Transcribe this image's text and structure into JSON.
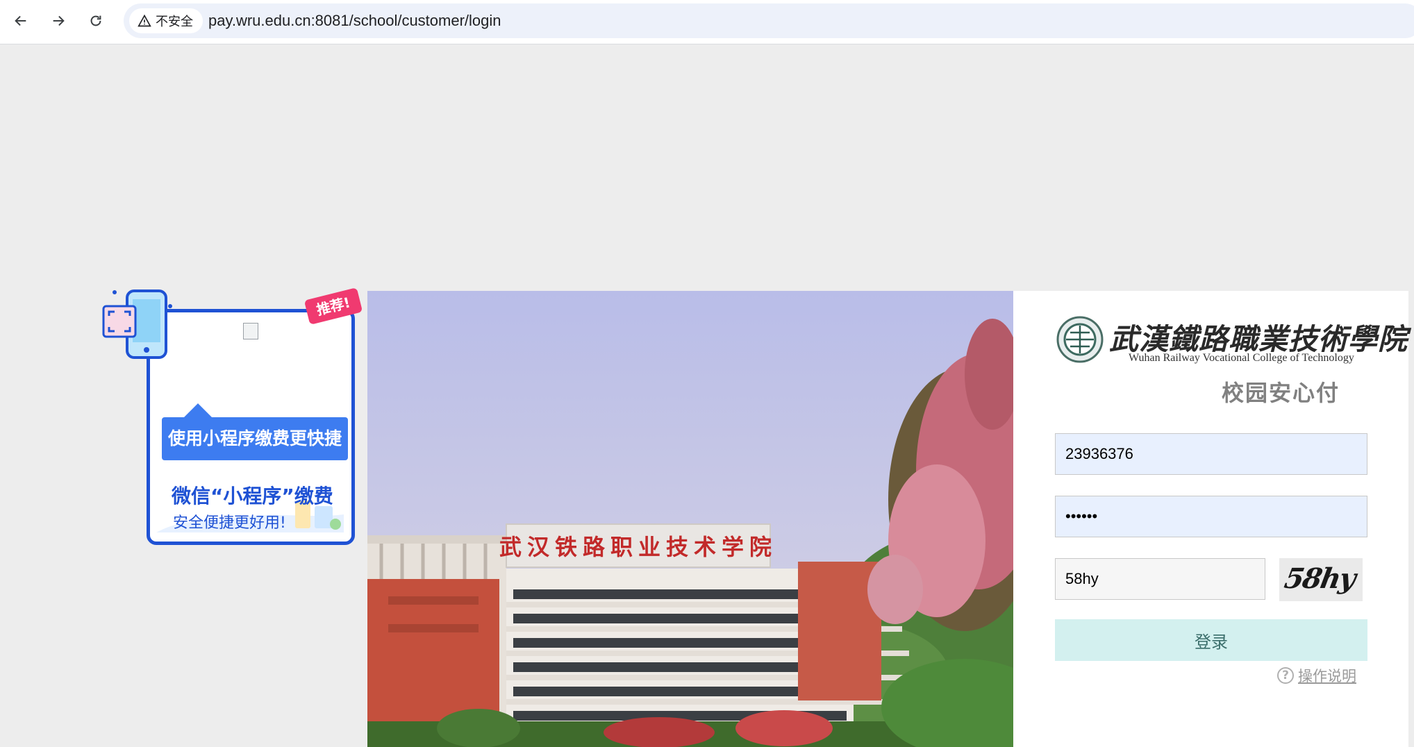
{
  "browser": {
    "security_label": "不安全",
    "url": "pay.wru.edu.cn:8081/school/customer/login"
  },
  "promo": {
    "tag": "推荐!",
    "bubble_text": "使用小程序缴费更快捷",
    "title": "微信“小程序”缴费",
    "subtitle": "安全便捷更好用!"
  },
  "photo": {
    "building_sign": "武汉铁路职业技术学院"
  },
  "school": {
    "name_cn": "武漢鐵路職業技術學院",
    "name_en": "Wuhan Railway Vocational College of Technology",
    "slogan": "校园安心付"
  },
  "form": {
    "username_value": "23936376",
    "password_value": "••••••",
    "captcha_value": "58hy",
    "captcha_image_text": "58hy",
    "login_label": "登录",
    "help_label": "操作说明"
  },
  "colors": {
    "promo_blue": "#1f52d4",
    "promo_bubble": "#3d7cf0",
    "promo_tag": "#f03a70",
    "login_button": "#d3f0ef",
    "autofill_bg": "#e8f0fe"
  }
}
